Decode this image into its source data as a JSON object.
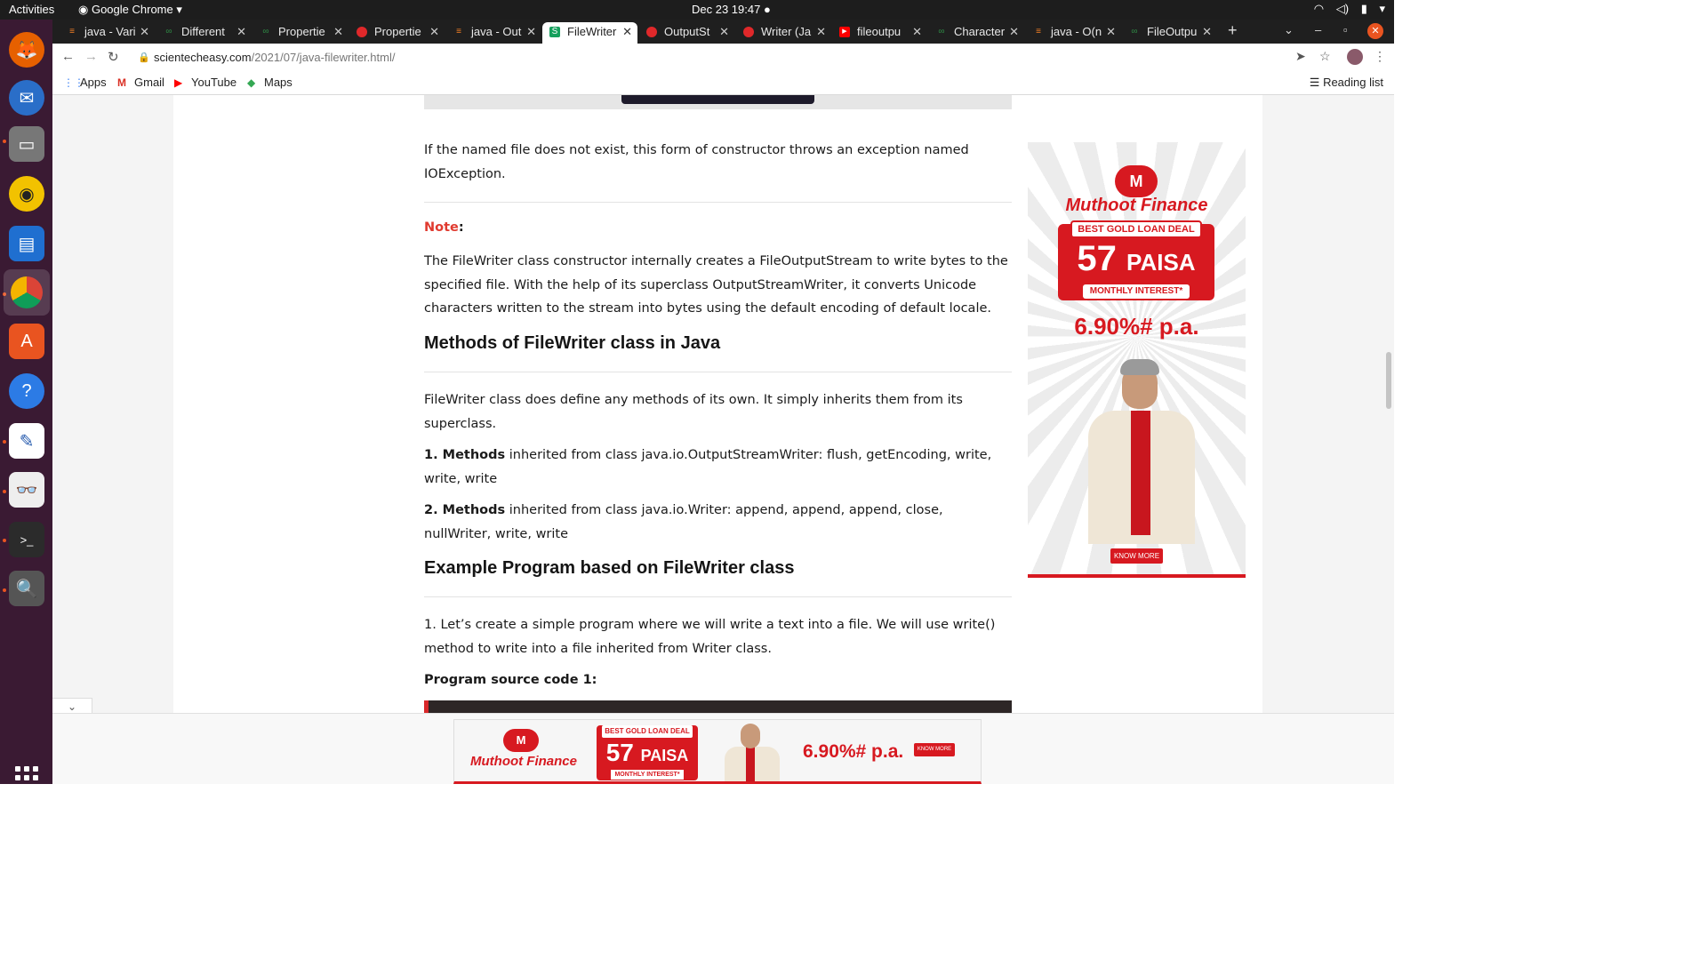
{
  "system": {
    "activities": "Activities",
    "app_name": "Google Chrome",
    "clock": "Dec 23  19:47"
  },
  "browser": {
    "tabs": [
      {
        "label": "java - Vari",
        "favicon": "stackoverflow-icon",
        "active": false
      },
      {
        "label": "Different",
        "favicon": "geeksforgeeks-icon",
        "active": false
      },
      {
        "label": "Propertie",
        "favicon": "geeksforgeeks-icon",
        "active": false
      },
      {
        "label": "Propertie",
        "favicon": "oracle-icon",
        "active": false
      },
      {
        "label": "java - Out",
        "favicon": "stackoverflow-icon",
        "active": false
      },
      {
        "label": "FileWriter",
        "favicon": "scientecheasy-icon",
        "active": true
      },
      {
        "label": "OutputSt",
        "favicon": "oracle-icon",
        "active": false
      },
      {
        "label": "Writer (Ja",
        "favicon": "oracle-icon",
        "active": false
      },
      {
        "label": "fileoutpu",
        "favicon": "youtube-icon",
        "active": false
      },
      {
        "label": "Character",
        "favicon": "geeksforgeeks-icon",
        "active": false
      },
      {
        "label": "java - O(n",
        "favicon": "stackoverflow-icon",
        "active": false
      },
      {
        "label": "FileOutpu",
        "favicon": "geeksforgeeks-icon",
        "active": false
      }
    ],
    "url_host": "scientecheasy.com",
    "url_path": "/2021/07/java-filewriter.html/",
    "bookmarks": [
      {
        "label": "Apps",
        "icon": "apps-grid-icon"
      },
      {
        "label": "Gmail",
        "icon": "gmail-icon"
      },
      {
        "label": "YouTube",
        "icon": "youtube-icon"
      },
      {
        "label": "Maps",
        "icon": "maps-icon"
      }
    ],
    "reading_list": "Reading list"
  },
  "article": {
    "para1": "If the named file does not exist, this form of constructor throws an exception named IOException.",
    "note_label": "Note",
    "note_colon": ":",
    "para2": "The FileWriter class constructor internally creates a FileOutputStream to write bytes to the specified file. With the help of its superclass OutputStreamWriter, it converts Unicode characters written to the stream into bytes using the default encoding of default locale.",
    "heading1": "Methods of FileWriter class in Java",
    "para3": "FileWriter class does define any methods of its own. It simply inherits them from its superclass.",
    "item1_bold": "1. Methods",
    "item1_text": " inherited from class java.io.OutputStreamWriter: flush, getEncoding, write, write, write",
    "item2_bold": "2. Methods",
    "item2_text": " inherited from class java.io.Writer: append, append, append, close, nullWriter, write, write",
    "heading2": "Example Program based on FileWriter class",
    "para4": "1. Let’s create a simple program where we will write a text into a file. We will use write() method to write into a file inherited from Writer class.",
    "source_label": "Program source code 1:"
  },
  "side_ad": {
    "logo": "M",
    "brand": "Muthoot Finance",
    "tag": "BEST GOLD LOAN DEAL",
    "big_number": "57",
    "big_unit": "PAISA",
    "sub": "MONTHLY INTEREST*",
    "rate": "6.90%# p.a.",
    "cta": "KNOW MORE"
  },
  "banner_ad": {
    "logo": "M",
    "brand": "Muthoot Finance",
    "tag": "BEST GOLD LOAN DEAL",
    "big_number": "57",
    "big_unit": "PAISA",
    "sub": "MONTHLY INTEREST*",
    "rate": "6.90%# p.a.",
    "cta": "KNOW MORE"
  },
  "colors": {
    "accent_red": "#d71920",
    "note_red": "#e03a2f",
    "dock_bg": "#3a1a33",
    "ubuntu_orange": "#e95420"
  }
}
